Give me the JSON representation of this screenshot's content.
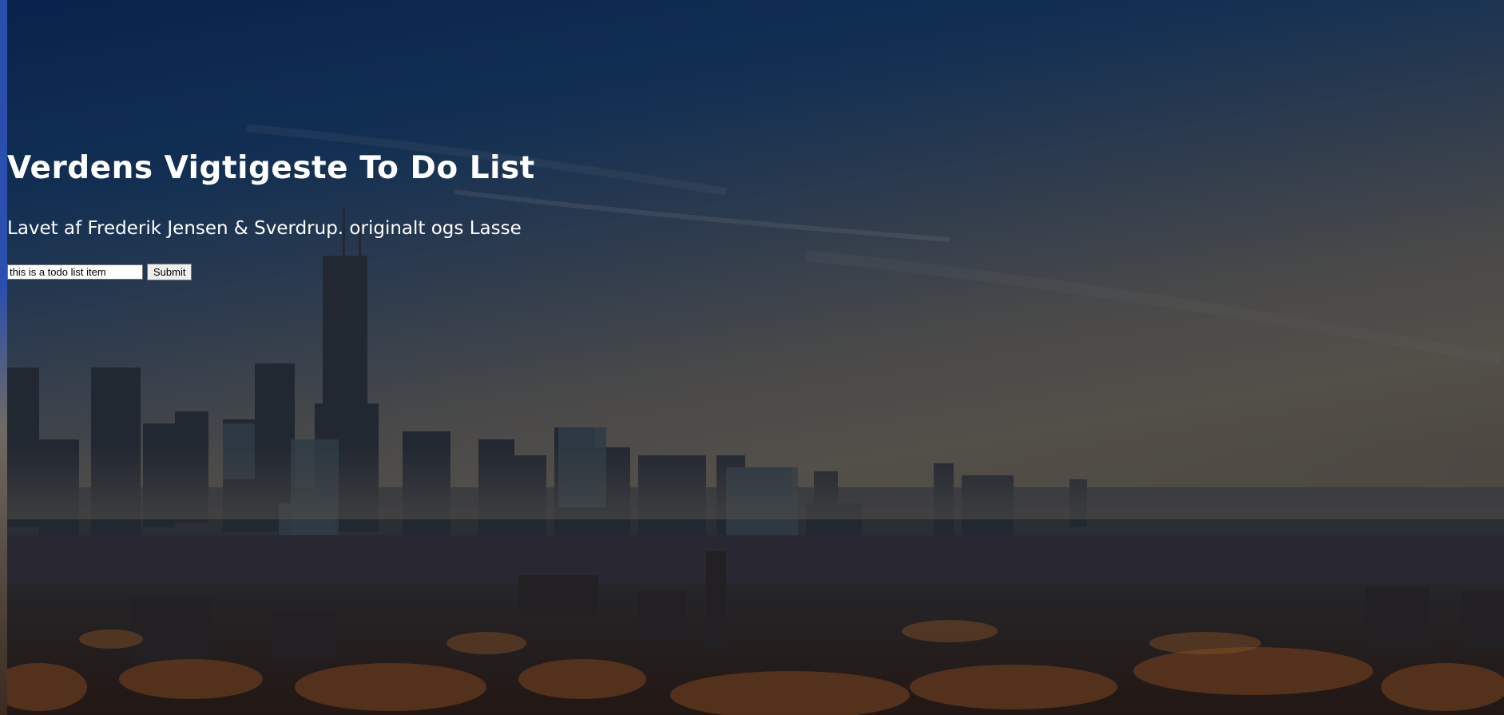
{
  "header": {
    "title": "Verdens Vigtigeste To Do List",
    "subtitle": "Lavet af Frederik Jensen & Sverdrup. originalt ogs Lasse"
  },
  "form": {
    "input_value": "this is a todo list item",
    "submit_label": "Submit"
  },
  "background": {
    "description_icon": "city-skyline-photo",
    "sky_top_color": "#0b2a5c",
    "sky_horizon_color": "#6b6558",
    "city_color": "#2b2f36",
    "foliage_color": "#8a4a1e"
  }
}
